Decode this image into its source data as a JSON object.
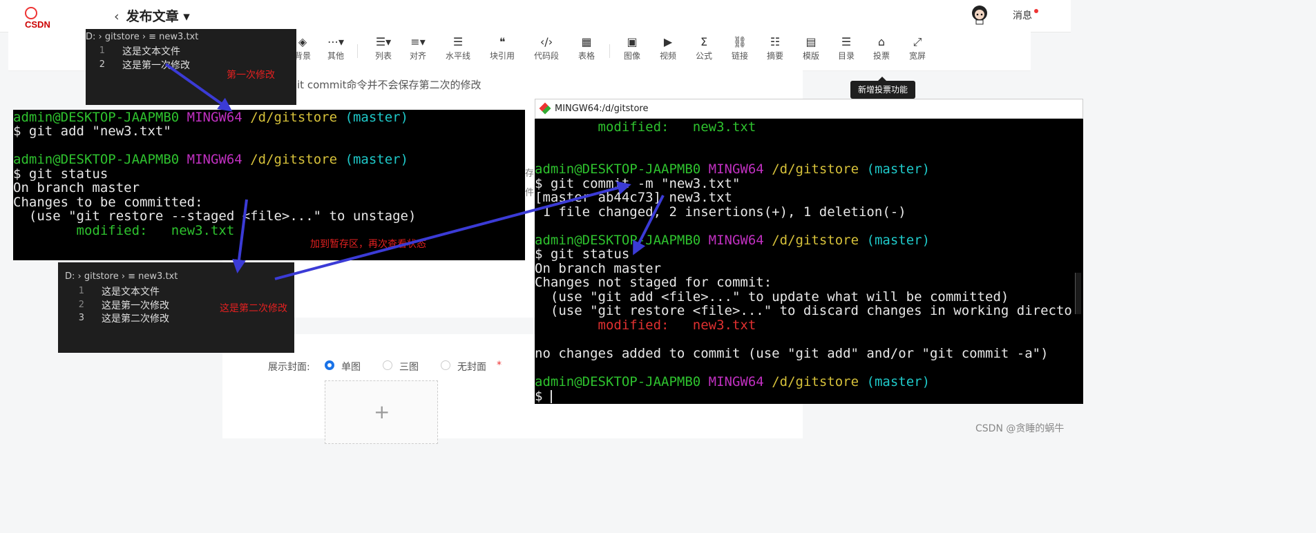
{
  "header": {
    "logo": "CSDN",
    "back": "‹",
    "title": "发布文章 ▾",
    "messages": "消息"
  },
  "toolbar": {
    "items": [
      {
        "icon": "paint-bucket-icon",
        "label": "背景"
      },
      {
        "icon": "more-icon",
        "label": "其他"
      },
      {
        "icon": "list-icon",
        "label": "列表"
      },
      {
        "icon": "align-icon",
        "label": "对齐"
      },
      {
        "icon": "hr-icon",
        "label": "水平线"
      },
      {
        "icon": "quote-icon",
        "label": "块引用"
      },
      {
        "icon": "code-icon",
        "label": "代码段"
      },
      {
        "icon": "table-icon",
        "label": "表格"
      },
      {
        "icon": "image-icon",
        "label": "图像"
      },
      {
        "icon": "video-icon",
        "label": "视频"
      },
      {
        "icon": "formula-icon",
        "label": "公式"
      },
      {
        "icon": "link-icon",
        "label": "链接"
      },
      {
        "icon": "summary-icon",
        "label": "摘要"
      },
      {
        "icon": "template-icon",
        "label": "模版"
      },
      {
        "icon": "toc-icon",
        "label": "目录"
      },
      {
        "icon": "vote-icon",
        "label": "投票"
      },
      {
        "icon": "widescreen-icon",
        "label": "宽屏"
      }
    ],
    "tooltip": "新增投票功能"
  },
  "article": {
    "line1": "it commit命令并不会保存第二次的修改",
    "frag1": "存",
    "frag2": "件"
  },
  "cover": {
    "label": "展示封面:",
    "options": [
      "单图",
      "三图",
      "无封面"
    ],
    "selected": "单图",
    "required": "*",
    "plus": "+"
  },
  "editor1": {
    "breadcrumb": "D: › gitstore › ≡ new3.txt",
    "lines": [
      {
        "n": "1",
        "text": "这是文本文件"
      },
      {
        "n": "2",
        "text": "这是第一次修改"
      }
    ]
  },
  "editor2": {
    "breadcrumb": "D: › gitstore › ≡ new3.txt",
    "lines": [
      {
        "n": "1",
        "text": "这是文本文件"
      },
      {
        "n": "2",
        "text": "这是第一次修改"
      },
      {
        "n": "3",
        "text": "这是第二次修改"
      }
    ]
  },
  "annotations": {
    "first_change": "第一次修改",
    "staged": "加到暂存区，再次查看状态",
    "second_change": "这是第二次修改"
  },
  "terminal1": {
    "prompt_user": "admin@DESKTOP-JAAPMB0",
    "prompt_sys": "MINGW64",
    "prompt_path": "/d/gitstore",
    "prompt_branch": "(master)",
    "cmd1": "$ git add \"new3.txt\"",
    "cmd2": "$ git status",
    "out1": "On branch master",
    "out2": "Changes to be committed:",
    "out3": "  (use \"git restore --staged <file>...\" to unstage)",
    "out4": "        modified:   new3.txt"
  },
  "terminal2": {
    "title": "MINGW64:/d/gitstore",
    "top_modified": "        modified:   new3.txt",
    "cmd_commit": "$ git commit -m \"new3.txt\"",
    "out_commit1": "[master ab44c73] new3.txt",
    "out_commit2": " 1 file changed, 2 insertions(+), 1 deletion(-)",
    "cmd_status": "$ git status",
    "out1": "On branch master",
    "out2": "Changes not staged for commit:",
    "out3": "  (use \"git add <file>...\" to update what will be committed)",
    "out4": "  (use \"git restore <file>...\" to discard changes in working directo",
    "out5": "        modified:   new3.txt",
    "out6": "no changes added to commit (use \"git add\" and/or \"git commit -a\")",
    "final_prompt": "$ "
  },
  "watermark": "CSDN @贪睡的蜗牛",
  "colors": {
    "terminal_green": "#2ec22e",
    "terminal_magenta": "#c030c0",
    "terminal_yellow": "#d6c13a",
    "terminal_cyan": "#1fc9c9",
    "annotation_red": "#e32020",
    "arrow_blue": "#3b3bd6"
  }
}
